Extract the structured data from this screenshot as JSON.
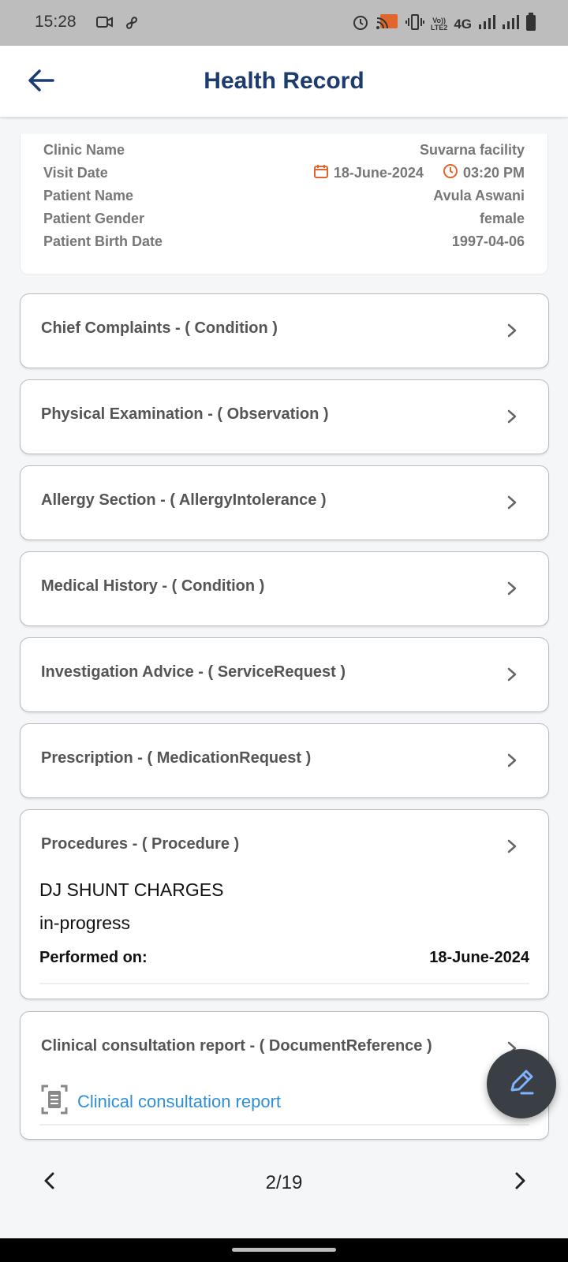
{
  "status_bar": {
    "time": "15:28",
    "network": "4G",
    "volte_line1": "Vo))",
    "volte_line2": "LTE2",
    "icons": [
      "camera-icon",
      "pinwheel-icon",
      "alarm-icon",
      "cast-icon",
      "vibrate-icon",
      "signal-icon",
      "signal-icon",
      "battery-icon"
    ]
  },
  "header": {
    "title": "Health Record",
    "back_icon": "arrow-left-icon"
  },
  "visit_info": {
    "clinic_label": "Clinic Name",
    "clinic_value": "Suvarna facility",
    "visit_date_label": "Visit Date",
    "visit_date": "18-June-2024",
    "visit_time": "03:20 PM",
    "patient_name_label": "Patient Name",
    "patient_name": "Avula Aswani",
    "gender_label": "Patient Gender",
    "gender": "female",
    "birth_label": "Patient Birth Date",
    "birth_date": "1997-04-06",
    "accent_color": "#e0662e"
  },
  "sections": [
    {
      "title": "Chief Complaints - ( Condition )"
    },
    {
      "title": "Physical Examination - ( Observation )"
    },
    {
      "title": "Allergy Section - ( AllergyIntolerance )"
    },
    {
      "title": "Medical History - ( Condition )"
    },
    {
      "title": "Investigation Advice - ( ServiceRequest )"
    },
    {
      "title": "Prescription - ( MedicationRequest )"
    },
    {
      "title": "Procedures - ( Procedure )",
      "procedure_name": "DJ SHUNT CHARGES",
      "procedure_status": "in-progress",
      "performed_label": "Performed on:",
      "performed_date": "18-June-2024"
    },
    {
      "title": "Clinical consultation report - ( DocumentReference )",
      "link_text": "Clinical consultation report",
      "link_color": "#2f8fd6"
    }
  ],
  "fab": {
    "icon": "edit-pen-icon"
  },
  "pager": {
    "label": "2/19"
  }
}
